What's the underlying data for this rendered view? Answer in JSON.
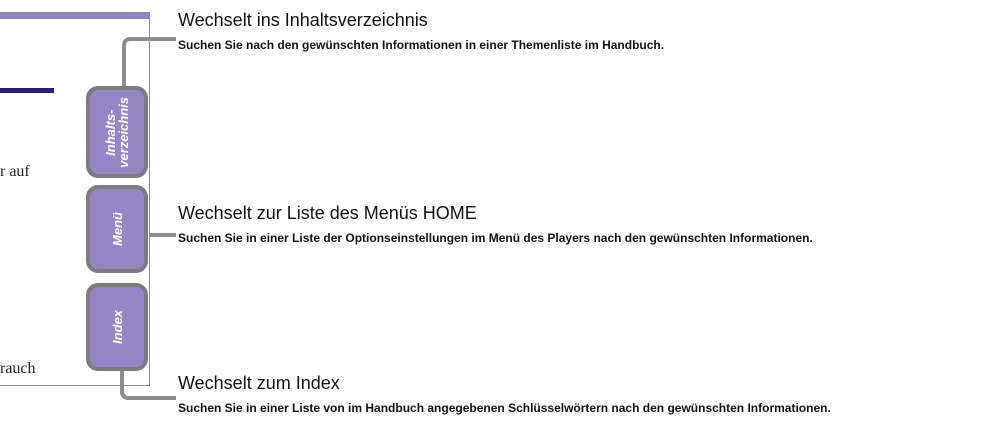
{
  "page_preview": {
    "fragment_1": "r auf",
    "fragment_2": "rauch"
  },
  "tabs": [
    {
      "id": "toc",
      "label": "Inhalts-\nverzeichnis"
    },
    {
      "id": "menu",
      "label": "Menü"
    },
    {
      "id": "index",
      "label": "Index"
    }
  ],
  "callouts": {
    "toc": {
      "title": "Wechselt ins Inhaltsverzeichnis",
      "description": "Suchen Sie nach den gewünschten Informationen in einer Themenliste im Handbuch."
    },
    "menu": {
      "title": "Wechselt zur Liste des Menüs HOME",
      "description": "Suchen Sie in einer Liste der Optionseinstellungen im Menü des Players nach den gewünschten Informationen."
    },
    "index": {
      "title": "Wechselt zum Index",
      "description": "Suchen Sie in einer Liste von im Handbuch angegebenen Schlüsselwörtern nach den gewünschten Informationen."
    }
  },
  "colors": {
    "tab_fill": "#9786c6",
    "tab_border": "#7c7c7c",
    "header_bar": "#8d86c2",
    "heading_rule": "#2a1f6e"
  }
}
